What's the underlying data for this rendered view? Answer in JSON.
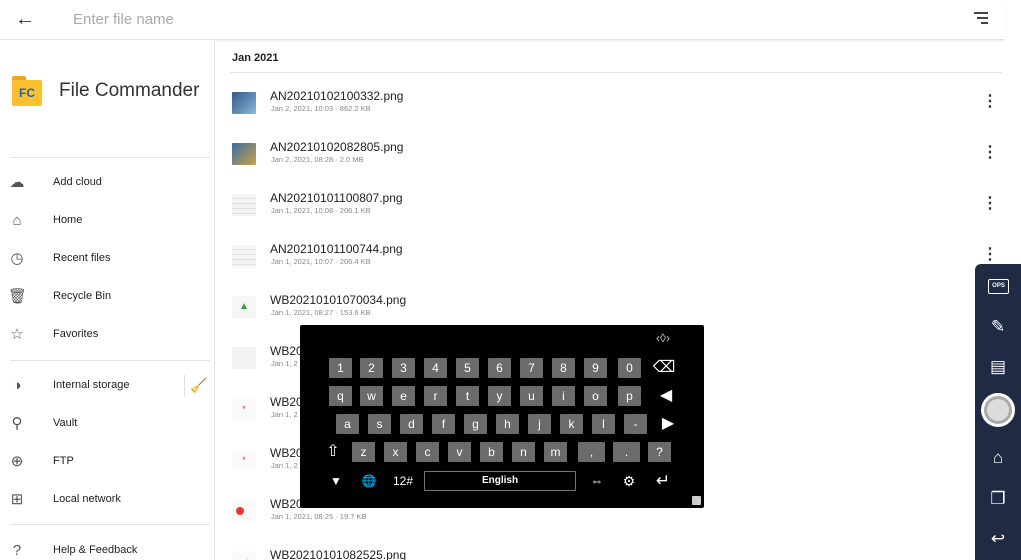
{
  "search": {
    "placeholder": "Enter file name"
  },
  "app": {
    "title": "File Commander",
    "logo_text": "FC"
  },
  "sidebar": {
    "items": [
      {
        "label": "Add cloud",
        "icon": "cloud-add-icon"
      },
      {
        "label": "Home",
        "icon": "home-icon"
      },
      {
        "label": "Recent files",
        "icon": "clock-icon"
      },
      {
        "label": "Recycle Bin",
        "icon": "trash-icon"
      },
      {
        "label": "Favorites",
        "icon": "star-icon"
      },
      {
        "label": "Internal storage",
        "icon": "storage-icon"
      },
      {
        "label": "Vault",
        "icon": "vault-icon"
      },
      {
        "label": "FTP",
        "icon": "ftp-icon"
      },
      {
        "label": "Local network",
        "icon": "network-icon"
      },
      {
        "label": "Help & Feedback",
        "icon": "help-icon"
      }
    ]
  },
  "main": {
    "section": "Jan 2021",
    "files": [
      {
        "name": "AN20210102100332.png",
        "meta": "Jan 2, 2021, 10:03 · 862.2 KB"
      },
      {
        "name": "AN20210102082805.png",
        "meta": "Jan 2, 2021, 08:28 · 2.0 MB"
      },
      {
        "name": "AN20210101100807.png",
        "meta": "Jan 1, 2021, 10:08 · 206.1 KB"
      },
      {
        "name": "AN20210101100744.png",
        "meta": "Jan 1, 2021, 10:07 · 206.4 KB"
      },
      {
        "name": "WB20210101070034.png",
        "meta": "Jan 1, 2021, 08:27 · 153.6 KB"
      },
      {
        "name": "WB20",
        "meta": "Jan 1, 2"
      },
      {
        "name": "WB20",
        "meta": "Jan 1, 2"
      },
      {
        "name": "WB20",
        "meta": "Jan 1, 2"
      },
      {
        "name": "WB20",
        "meta": "Jan 1, 2021, 08:25 · 19.7 KB"
      },
      {
        "name": "WB20210101082525.png",
        "meta": ""
      }
    ]
  },
  "keyboard": {
    "row1": [
      "1",
      "2",
      "3",
      "4",
      "5",
      "6",
      "7",
      "8",
      "9",
      "0"
    ],
    "row2": [
      "q",
      "w",
      "e",
      "r",
      "t",
      "y",
      "u",
      "i",
      "o",
      "p"
    ],
    "row3": [
      "a",
      "s",
      "d",
      "f",
      "g",
      "h",
      "j",
      "k",
      "l",
      "-"
    ],
    "row4": [
      "z",
      "x",
      "c",
      "v",
      "b",
      "n",
      "m",
      ",",
      ".",
      "?"
    ],
    "symbols_label": "12#",
    "space_label": "English",
    "backspace": "⌫",
    "left": "◀",
    "right": "▶",
    "shift": "⇧",
    "hide": "▼",
    "globe": "🌐",
    "cursor": "⇔",
    "settings": "⚙",
    "enter": "↵"
  },
  "tools": {
    "ops_label": "OPS",
    "items": [
      "annotate-icon",
      "whiteboard-icon",
      "record-icon",
      "home-icon",
      "windows-icon",
      "return-icon"
    ]
  }
}
